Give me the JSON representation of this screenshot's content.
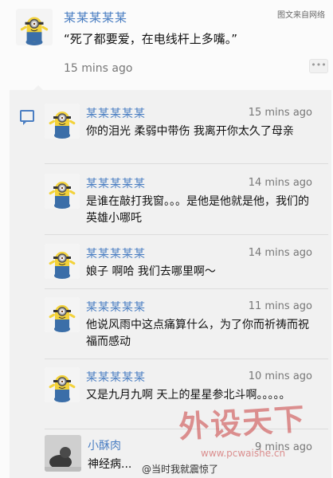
{
  "credit": "图文来自网络",
  "post": {
    "author": "某某某某某",
    "text": "“死了都要爱，在电线杆上多嘴。”",
    "time": "15 mins ago",
    "more_icon": "ellipsis-icon"
  },
  "comments_icon": "comment-bubble-icon",
  "comments": [
    {
      "author": "某某某某某",
      "time": "15 mins ago",
      "text": "你的泪光 柔弱中带伤 我离开你太久了母亲"
    },
    {
      "author": "某某某某某",
      "time": "14 mins ago",
      "text": "是谁在敲打我窗。。。是他是他就是他，我们的英雄小哪吒"
    },
    {
      "author": "某某某某某",
      "time": "14 mins ago",
      "text": "娘子 啊哈 我们去哪里啊～"
    },
    {
      "author": "某某某某某",
      "time": "11 mins ago",
      "text": "他说风雨中这点痛算什么，为了你而祈祷而祝福而感动"
    },
    {
      "author": "某某某某某",
      "time": "10 mins ago",
      "text": "又是九月九啊 天上的星星参北斗啊。。。。。"
    }
  ],
  "reply": {
    "author": "小酥肉",
    "text": "神经病...",
    "time": "9 mins ago"
  },
  "watermark": {
    "text": "外设天下",
    "url": "www.pcwaishe.cn",
    "weibo": "@当时我就震惊了"
  }
}
